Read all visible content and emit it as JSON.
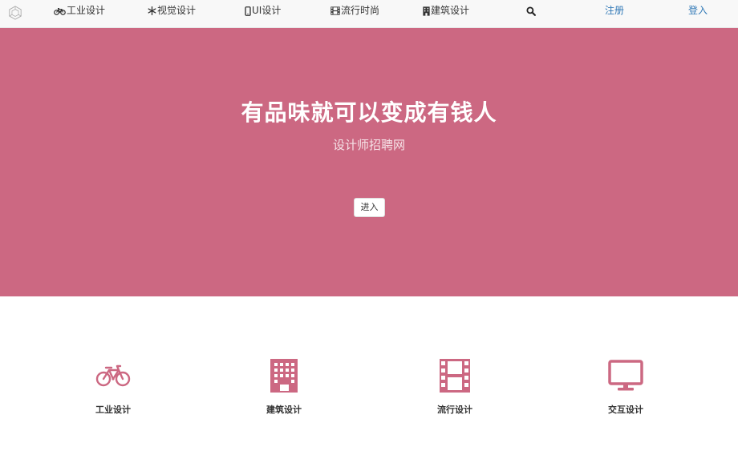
{
  "nav": {
    "logo": "logo-icon",
    "items": [
      {
        "label": "工业设计",
        "icon": "bicycle-icon"
      },
      {
        "label": "视觉设计",
        "icon": "snowflake-icon"
      },
      {
        "label": "UI设计",
        "icon": "mobile-icon"
      },
      {
        "label": "流行时尚",
        "icon": "film-icon"
      },
      {
        "label": "建筑设计",
        "icon": "building-icon"
      }
    ],
    "search_icon": "search-icon",
    "register": "注册",
    "login": "登入"
  },
  "hero": {
    "title": "有品味就可以变成有钱人",
    "subtitle": "设计师招聘网",
    "enter_button": "进入",
    "background_color": "#cc6882"
  },
  "features": [
    {
      "label": "工业设计",
      "icon": "bicycle-icon"
    },
    {
      "label": "建筑设计",
      "icon": "building-icon"
    },
    {
      "label": "流行设计",
      "icon": "film-icon"
    },
    {
      "label": "交互设计",
      "icon": "monitor-icon"
    }
  ],
  "colors": {
    "accent": "#cc6882",
    "link": "#337ab7",
    "navbar_bg": "#f8f8f8"
  }
}
